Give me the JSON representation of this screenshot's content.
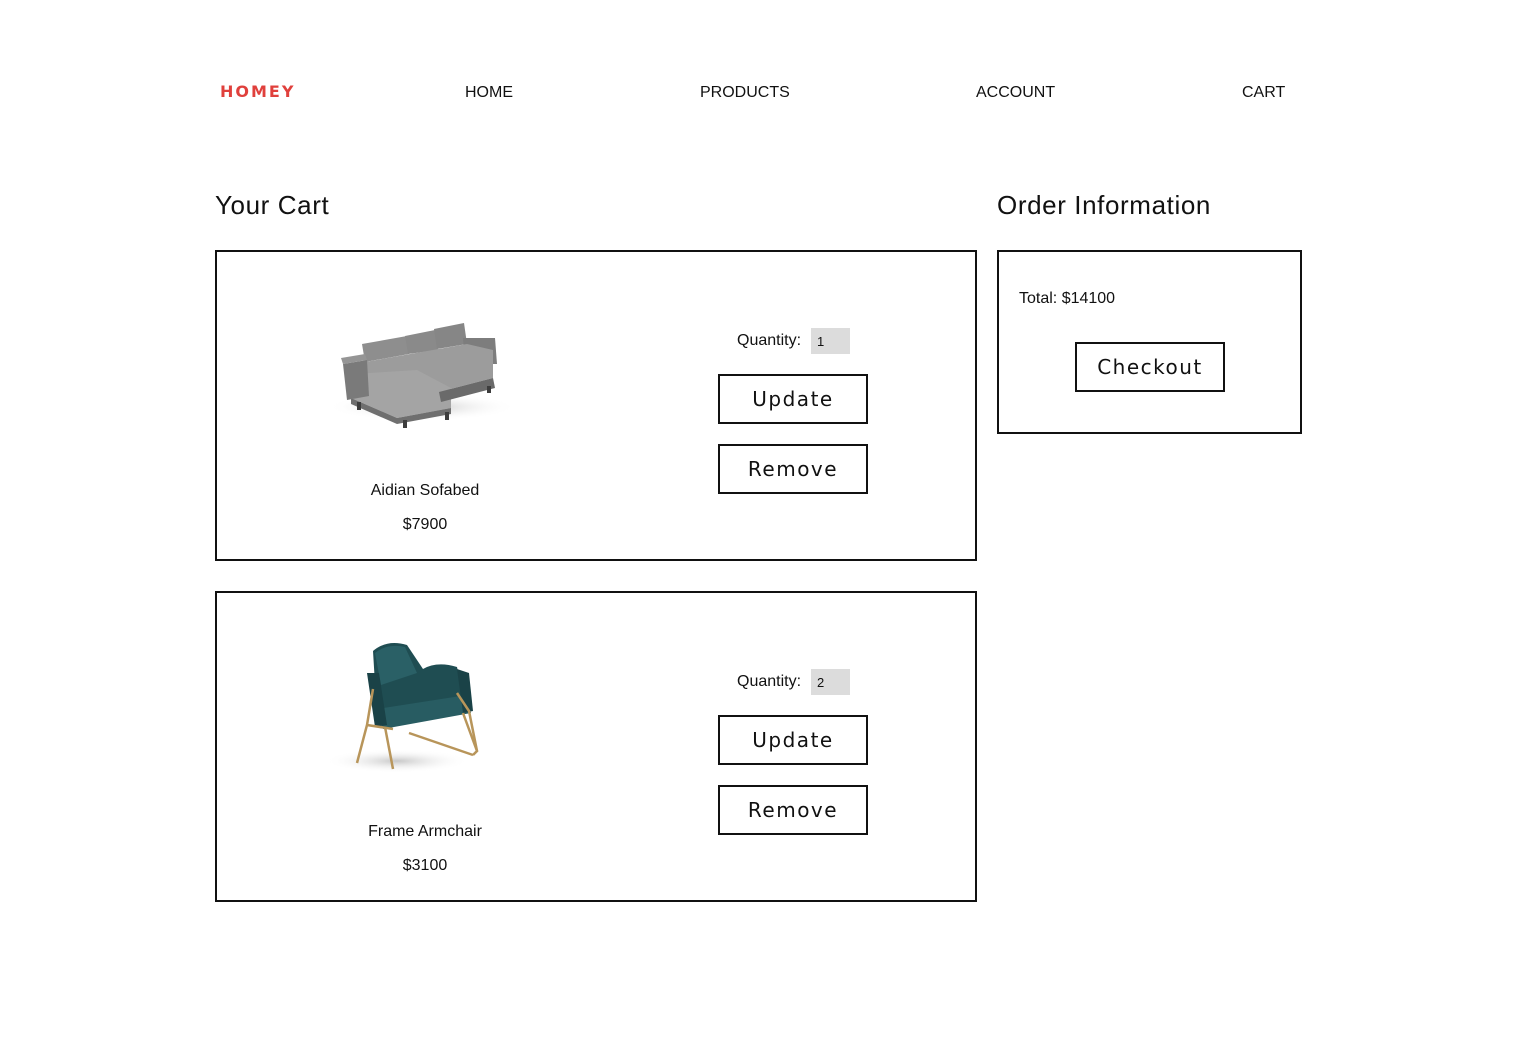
{
  "header": {
    "brand": "HOMEY",
    "nav": [
      {
        "label": "HOME"
      },
      {
        "label": "PRODUCTS"
      },
      {
        "label": "ACCOUNT"
      },
      {
        "label": "CART"
      }
    ]
  },
  "cart": {
    "title": "Your Cart",
    "quantity_label": "Quantity:",
    "update_label": "Update",
    "remove_label": "Remove",
    "items": [
      {
        "name": "Aidian Sofabed",
        "price": "$7900",
        "quantity": "1",
        "image_icon": "sofa-icon"
      },
      {
        "name": "Frame Armchair",
        "price": "$3100",
        "quantity": "2",
        "image_icon": "armchair-icon"
      }
    ]
  },
  "order": {
    "title": "Order Information",
    "total": "Total: $14100",
    "checkout_label": "Checkout"
  },
  "colors": {
    "brand": "#e0403c",
    "border": "#111111",
    "input_bg": "#dcdcdc"
  }
}
